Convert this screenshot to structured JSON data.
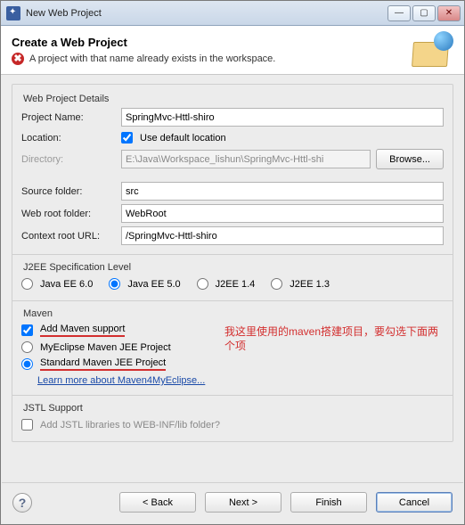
{
  "window": {
    "title": "New Web Project"
  },
  "banner": {
    "title": "Create a Web Project",
    "error": "A project with that name already exists in the workspace."
  },
  "details": {
    "section_label": "Web Project Details",
    "project_name_label": "Project Name:",
    "project_name_value": "SpringMvc-Httl-shiro",
    "location_label": "Location:",
    "use_default_label": "Use default location",
    "use_default_checked": true,
    "directory_label": "Directory:",
    "directory_value": "E:\\Java\\Workspace_lishun\\SpringMvc-Httl-shi",
    "browse_label": "Browse...",
    "source_folder_label": "Source folder:",
    "source_folder_value": "src",
    "web_root_label": "Web root folder:",
    "web_root_value": "WebRoot",
    "context_url_label": "Context root URL:",
    "context_url_value": "/SpringMvc-Httl-shiro"
  },
  "j2ee": {
    "section_label": "J2EE Specification Level",
    "options": [
      "Java EE 6.0",
      "Java EE 5.0",
      "J2EE 1.4",
      "J2EE 1.3"
    ],
    "selected": 1
  },
  "maven": {
    "section_label": "Maven",
    "add_support_label": "Add Maven support",
    "add_support_checked": true,
    "proj_options": [
      "MyEclipse Maven JEE Project",
      "Standard Maven JEE Project"
    ],
    "proj_selected": 1,
    "learn_more": "Learn more about Maven4MyEclipse...",
    "annotation": "我这里使用的maven搭建项目，要勾选下面两个项"
  },
  "jstl": {
    "section_label": "JSTL Support",
    "add_label": "Add JSTL libraries to WEB-INF/lib folder?",
    "checked": false
  },
  "footer": {
    "back": "< Back",
    "next": "Next >",
    "finish": "Finish",
    "cancel": "Cancel"
  }
}
